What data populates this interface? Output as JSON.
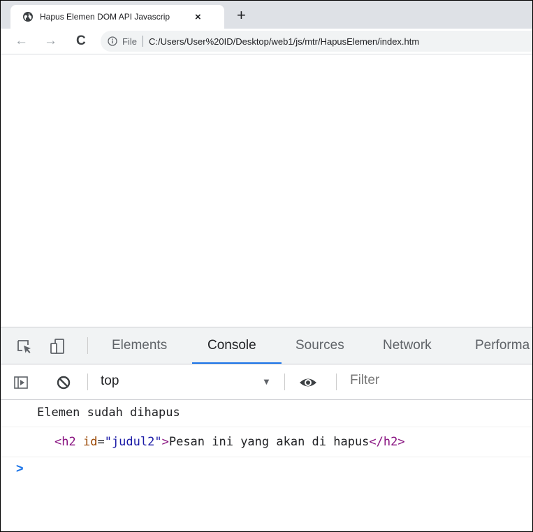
{
  "browser": {
    "tab_title": "Hapus Elemen DOM API Javascrip",
    "tab_close": "×",
    "new_tab": "+",
    "nav": {
      "back": "←",
      "forward": "→",
      "reload": "C"
    },
    "omnibox": {
      "scheme_label": "File",
      "url": "C:/Users/User%20ID/Desktop/web1/js/mtr/HapusElemen/index.htm"
    }
  },
  "devtools": {
    "tabs": [
      "Elements",
      "Console",
      "Sources",
      "Network",
      "Performa"
    ],
    "active_tab": "Console",
    "console": {
      "context": "top",
      "filter_placeholder": "Filter",
      "messages": [
        "Elemen sudah dihapus"
      ],
      "logged_element": {
        "tag_open": "<h2",
        "attr_name": "id",
        "attr_eq": "=",
        "attr_value": "\"judul2\"",
        "tag_close_bracket": ">",
        "text": "Pesan ini yang akan di hapus",
        "end_tag": "</h2>"
      },
      "prompt": ">"
    }
  },
  "colors": {
    "accent": "#1a73e8",
    "tabstrip": "#dee1e6",
    "devtools_bar": "#f1f3f4"
  }
}
